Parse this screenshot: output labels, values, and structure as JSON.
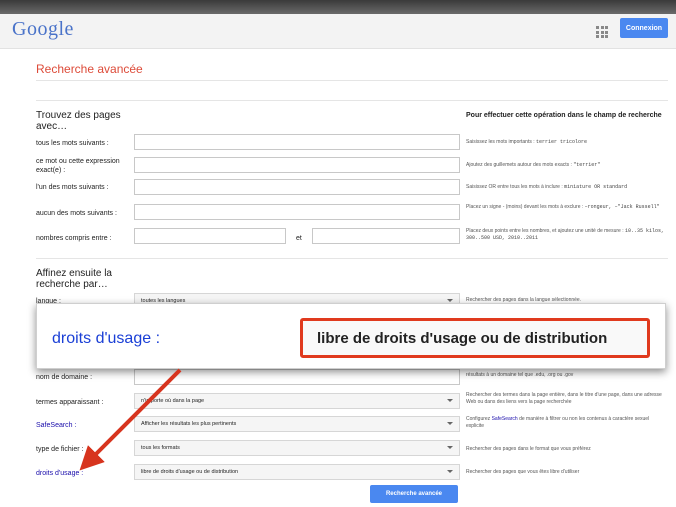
{
  "header": {
    "logo_text": "Google",
    "connexion_label": "Connexion",
    "apps_icon": "apps-grid-icon"
  },
  "page": {
    "title": "Recherche avancée"
  },
  "find": {
    "heading": "Trouvez des pages avec…",
    "right_heading": "Pour effectuer cette opération dans le champ de recherche",
    "rows": [
      {
        "label": "tous les mots suivants :",
        "value": "",
        "hint_text": "Saisissez les mots importants : ",
        "hint_example": "terrier tricolore"
      },
      {
        "label": "ce mot ou cette expression exact(e) :",
        "value": "",
        "hint_text": "Ajoutez des guillemets autour des mots exacts : ",
        "hint_example": "\"terrier\""
      },
      {
        "label": "l'un des mots suivants :",
        "value": "",
        "hint_text": "Saisissez OR entre tous les mots à inclure : ",
        "hint_example": "miniature OR standard"
      },
      {
        "label": "aucun des mots suivants :",
        "value": "",
        "hint_text": "Placez un signe - (moins) devant les mots à exclure : ",
        "hint_example": "–rongeur, –\"Jack Russell\""
      },
      {
        "label": "nombres compris entre :",
        "value": "",
        "hint_text": "Placez deux points entre les nombres, et ajoutez une unité de mesure : ",
        "hint_example": "10..35 kilos, 300..500 USD, 2010..2011"
      }
    ],
    "between_label": "et"
  },
  "refine": {
    "heading": "Affinez ensuite la recherche par…",
    "rows": [
      {
        "label": "langue :",
        "value": "toutes les langues",
        "hint": "Rechercher des pages dans la langue sélectionnée."
      },
      {
        "label": "nom de domaine :",
        "value": "",
        "hint": "résultats à un domaine tel que .edu, .org ou .gov"
      },
      {
        "label": "termes apparaissant :",
        "value": "n'importe où dans la page",
        "hint": "Rechercher des termes dans la page entière, dans le titre d'une page, dans une adresse Web ou dans des liens vers la page recherchée"
      },
      {
        "label": "SafeSearch :",
        "value": "Afficher les résultats les plus pertinents",
        "hint_prefix": "Configurez ",
        "hint_link": "SafeSearch",
        "hint_suffix": " de manière à filtrer ou non les contenus à caractère sexuel explicite"
      },
      {
        "label": "type de fichier :",
        "value": "tous les formats",
        "hint": "Rechercher des pages dans le format que vous préférez"
      },
      {
        "label": "droits d'usage :",
        "value": "libre de droits d'usage ou de distribution",
        "hint": "Rechercher des pages que vous êtes libre d'utiliser"
      }
    ]
  },
  "zoom_callout": {
    "label": "droits d'usage :",
    "value": "libre de droits d'usage ou de distribution",
    "highlight_color": "#e03a1e",
    "arrow_color": "#d7341e"
  },
  "submit_label": "Recherche avancée"
}
